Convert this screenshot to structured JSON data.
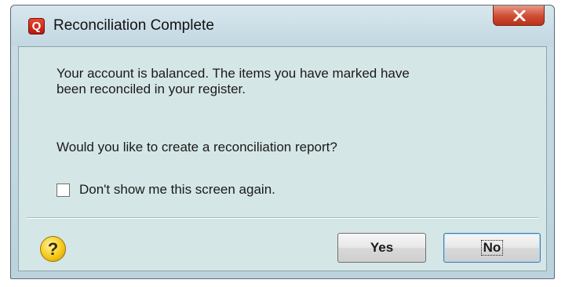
{
  "window": {
    "title": "Reconciliation Complete",
    "app_icon_letter": "Q"
  },
  "message": {
    "line1": "Your account is balanced.  The items you have marked have",
    "line2": "been reconciled in your register.",
    "question": "Would you like to create a reconciliation report?"
  },
  "checkbox": {
    "label": "Don't show me this screen again.",
    "checked": false
  },
  "help": {
    "glyph": "?"
  },
  "buttons": {
    "yes_label": "Yes",
    "no_label": "No",
    "default": "No"
  },
  "colors": {
    "window_bg": "#c9dde6",
    "content_bg": "#d5e6e6",
    "close_red": "#d04b32",
    "focus_border": "#3c7fb1"
  },
  "icons": {
    "app": "quicken-q-icon",
    "close": "close-icon",
    "help": "help-icon"
  }
}
